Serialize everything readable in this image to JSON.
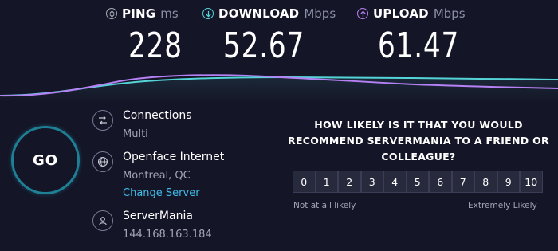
{
  "metrics": {
    "ping": {
      "label": "PING",
      "unit": "ms",
      "value": "228",
      "icon": "ping-icon",
      "color": "#a9abb8"
    },
    "download": {
      "label": "DOWNLOAD",
      "unit": "Mbps",
      "value": "52.67",
      "icon": "download-arrow-icon",
      "color": "#54d4d7"
    },
    "upload": {
      "label": "UPLOAD",
      "unit": "Mbps",
      "value": "61.47",
      "icon": "upload-arrow-icon",
      "color": "#b581f4"
    }
  },
  "graph": {
    "download_color": "#54d4d7",
    "upload_color": "#b581f4"
  },
  "go_button": {
    "label": "GO",
    "ring_color": "#1e7f95"
  },
  "connections": {
    "title": "Connections",
    "value": "Multi",
    "icon": "connections-icon"
  },
  "provider": {
    "title": "Openface Internet",
    "location": "Montreal, QC",
    "change_link": "Change Server",
    "icon": "globe-icon"
  },
  "host": {
    "title": "ServerMania",
    "ip": "144.168.163.184",
    "icon": "user-icon"
  },
  "survey": {
    "question": "HOW LIKELY IS IT THAT YOU WOULD RECOMMEND SERVERMANIA TO A FRIEND OR COLLEAGUE?",
    "scale": [
      "0",
      "1",
      "2",
      "3",
      "4",
      "5",
      "6",
      "7",
      "8",
      "9",
      "10"
    ],
    "low_label": "Not at all likely",
    "high_label": "Extremely Likely"
  }
}
